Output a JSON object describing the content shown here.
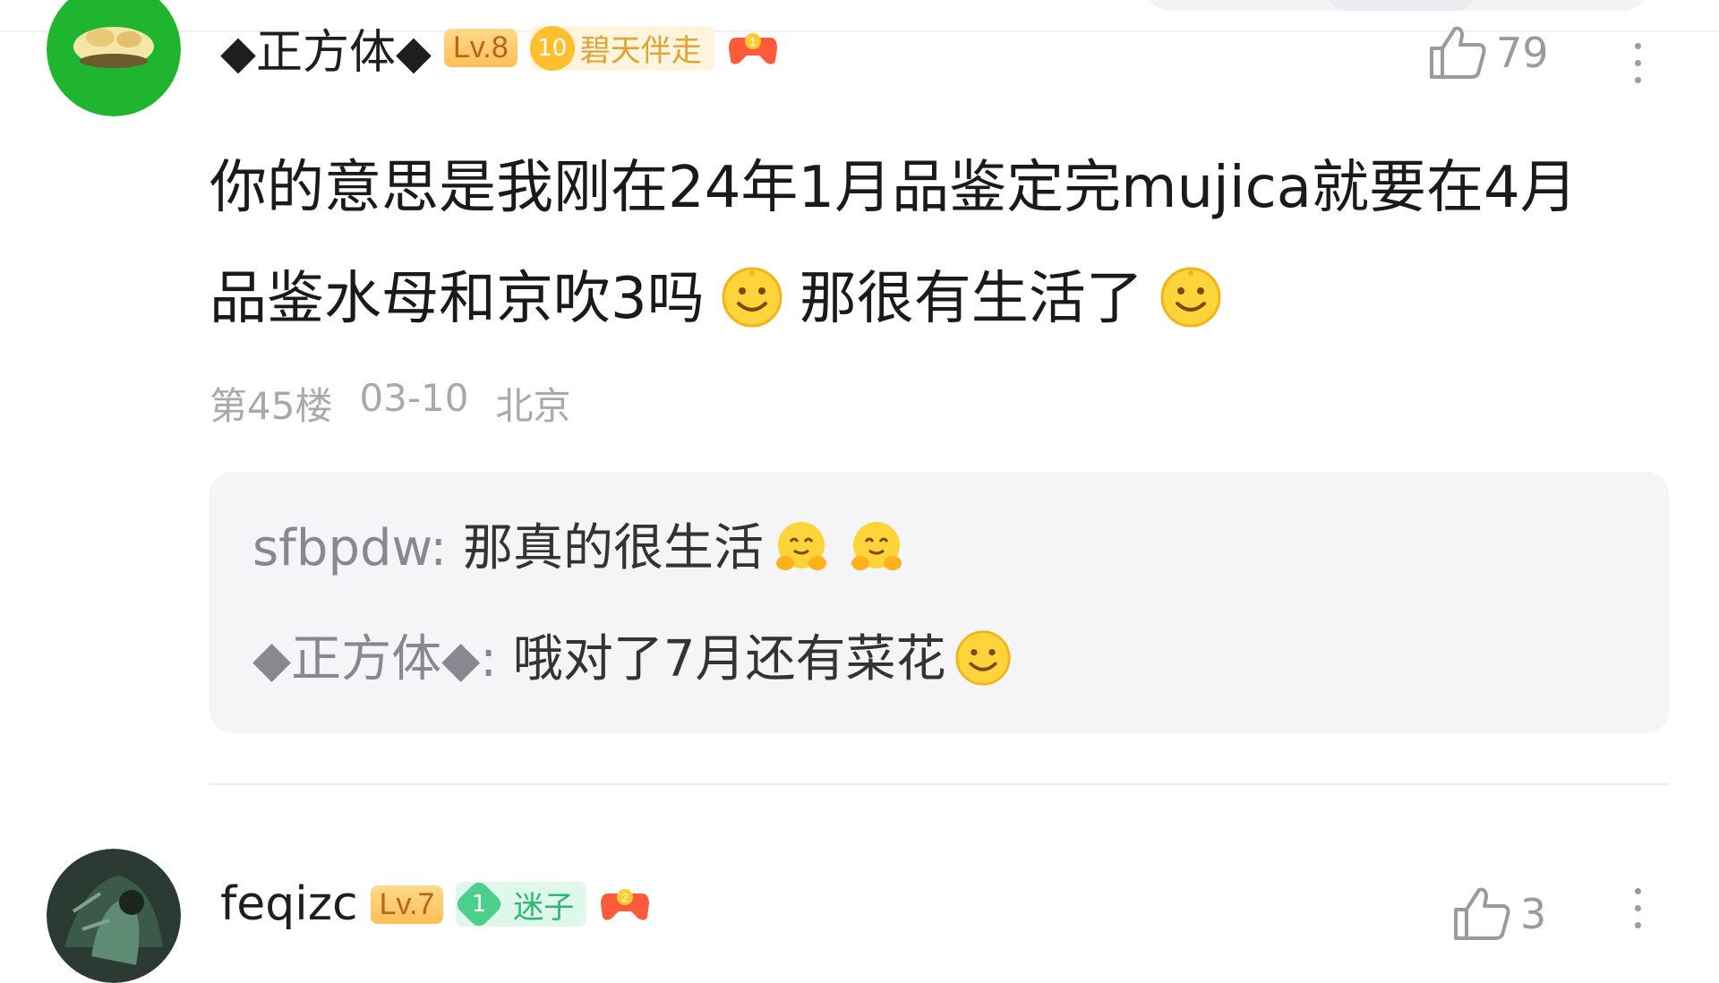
{
  "comment1": {
    "username": "◆正方体◆",
    "level": "Lv.8",
    "fan_badge": {
      "num": "10",
      "text": "碧天伴走"
    },
    "game_badge_num": "1",
    "likes": "79",
    "text_line1": "你的意思是我刚在24年1月品鉴定完mujica就要在4月",
    "text_line2_a": "品鉴水母和京吹3吗",
    "text_line2_b": "那很有生活了",
    "floor": "第45楼",
    "date": "03-10",
    "location": "北京",
    "replies": [
      {
        "author": "sfbpdw",
        "sep": ":",
        "text": "那真的很生活"
      },
      {
        "author": "◆正方体◆",
        "sep": ":",
        "text": "哦对了7月还有菜花"
      }
    ]
  },
  "comment2": {
    "username": "feqizc",
    "level": "Lv.7",
    "fan_badge": {
      "num": "1",
      "text": "迷子"
    },
    "game_badge_num": "2",
    "likes": "3"
  },
  "colors": {
    "accent_gold": "#ffbf2e",
    "accent_green": "#4ccf8c",
    "meta_gray": "#a8a8ad",
    "reply_bg": "#f5f5f7"
  },
  "icons": [
    "thumb-up-icon",
    "more-vertical-icon",
    "smile-emoji-icon",
    "hug-emoji-icon",
    "gamepad-icon"
  ]
}
